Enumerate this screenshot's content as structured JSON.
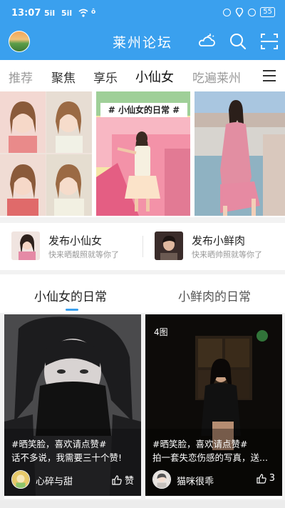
{
  "status": {
    "time": "13:07",
    "signal1": "5il",
    "signal2": "5il",
    "extra": "ô",
    "battery": "55"
  },
  "header": {
    "title": "莱州论坛"
  },
  "tabs": [
    {
      "label": "推荐"
    },
    {
      "label": "聚焦"
    },
    {
      "label": "享乐"
    },
    {
      "label": "小仙女",
      "active": true
    },
    {
      "label": "吃遍莱州"
    }
  ],
  "banner": {
    "tagline": "# 小仙女的日常 #"
  },
  "publish": [
    {
      "title": "发布小仙女",
      "subtitle": "快来晒靓照就等你了"
    },
    {
      "title": "发布小鲜肉",
      "subtitle": "快来晒帅照就等你了"
    }
  ],
  "sections": [
    {
      "label": "小仙女的日常",
      "active": true
    },
    {
      "label": "小鲜肉的日常",
      "active": false
    }
  ],
  "cards": [
    {
      "badge": "",
      "line1": "#晒笑脸，喜欢请点赞#",
      "line2": "话不多说，我需要三十个赞!",
      "user": "心碎与甜",
      "likes": "赞"
    },
    {
      "badge": "4图",
      "line1": "#晒笑脸，喜欢请点赞#",
      "line2": "拍一套失恋伤感的写真，送...",
      "user": "猫咪很乖",
      "likes": "3"
    }
  ],
  "icons": [
    "logo-avatar-icon",
    "weather-icon",
    "search-icon",
    "scan-icon",
    "menu-icon",
    "thumb-up-icon"
  ],
  "colors": {
    "brand": "#3aa0ee",
    "text": "#222222",
    "muted": "#999999"
  }
}
